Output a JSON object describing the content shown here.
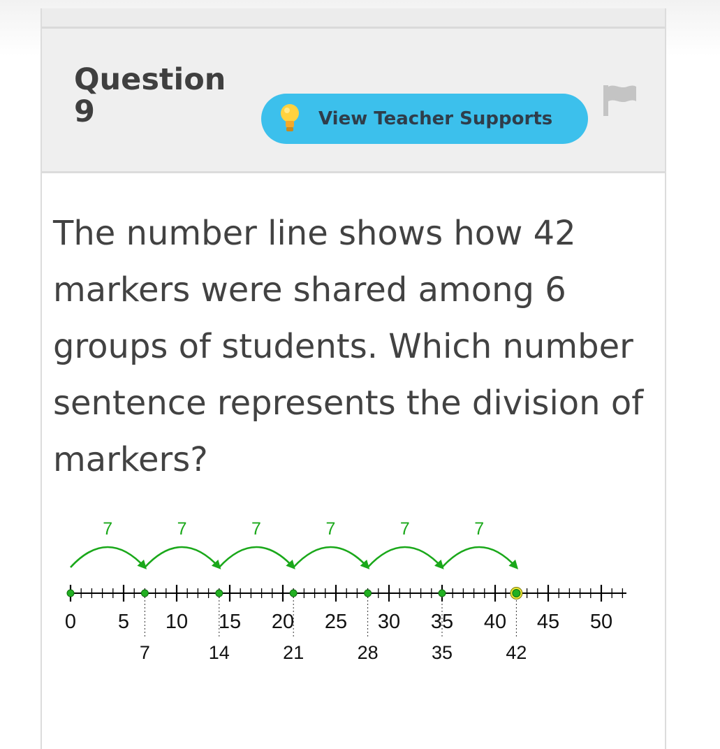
{
  "question": {
    "title": "Question 9",
    "support_button_label": "View Teacher Supports",
    "text": "The number line shows how 42 markers were shared among 6 groups of students. Which number sentence represents the division of markers?"
  },
  "icons": {
    "support_icon": "lightbulb-icon",
    "flag_icon": "flag-icon"
  },
  "colors": {
    "support_button_bg": "#3cc0ec",
    "jump_color": "#1aa81a",
    "point_color": "#22b022",
    "endpoint_highlight": "#f2ea3c"
  },
  "number_line": {
    "min": 0,
    "max": 50,
    "minor_step": 1,
    "major_step": 5,
    "major_labels": [
      "0",
      "5",
      "10",
      "15",
      "20",
      "25",
      "30",
      "35",
      "40",
      "45",
      "50"
    ],
    "jump_size": 7,
    "jump_labels": [
      "7",
      "7",
      "7",
      "7",
      "7",
      "7"
    ],
    "points": [
      0,
      7,
      14,
      21,
      28,
      35,
      42
    ],
    "point_labels": [
      "7",
      "14",
      "21",
      "28",
      "35",
      "42"
    ]
  }
}
